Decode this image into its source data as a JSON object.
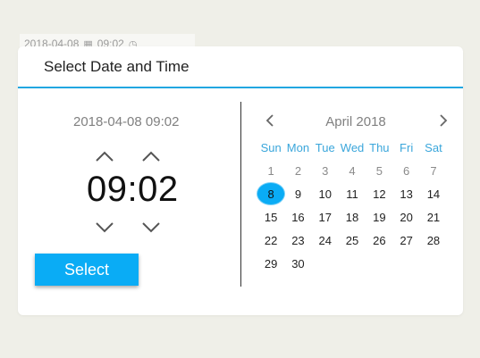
{
  "background_input": {
    "text": "2018-04-08",
    "time": "09:02"
  },
  "dialog": {
    "title": "Select Date and Time",
    "date_display": "2018-04-08 09:02",
    "time": "09:02",
    "select_label": "Select"
  },
  "calendar": {
    "month_label": "April 2018",
    "weekdays": [
      "Sun",
      "Mon",
      "Tue",
      "Wed",
      "Thu",
      "Fri",
      "Sat"
    ],
    "days": [
      {
        "label": "1",
        "muted": true
      },
      {
        "label": "2",
        "muted": true
      },
      {
        "label": "3",
        "muted": true
      },
      {
        "label": "4",
        "muted": true
      },
      {
        "label": "5",
        "muted": true
      },
      {
        "label": "6",
        "muted": true
      },
      {
        "label": "7",
        "muted": true
      },
      {
        "label": "8",
        "selected": true
      },
      {
        "label": "9"
      },
      {
        "label": "10"
      },
      {
        "label": "11"
      },
      {
        "label": "12"
      },
      {
        "label": "13"
      },
      {
        "label": "14"
      },
      {
        "label": "15"
      },
      {
        "label": "16"
      },
      {
        "label": "17"
      },
      {
        "label": "18"
      },
      {
        "label": "19"
      },
      {
        "label": "20"
      },
      {
        "label": "21"
      },
      {
        "label": "22"
      },
      {
        "label": "23"
      },
      {
        "label": "24"
      },
      {
        "label": "25"
      },
      {
        "label": "26"
      },
      {
        "label": "27"
      },
      {
        "label": "28"
      },
      {
        "label": "29"
      },
      {
        "label": "30"
      }
    ]
  },
  "colors": {
    "accent": "#0aacf5",
    "header_line": "#21a7e1",
    "weekday": "#3aa6db"
  }
}
